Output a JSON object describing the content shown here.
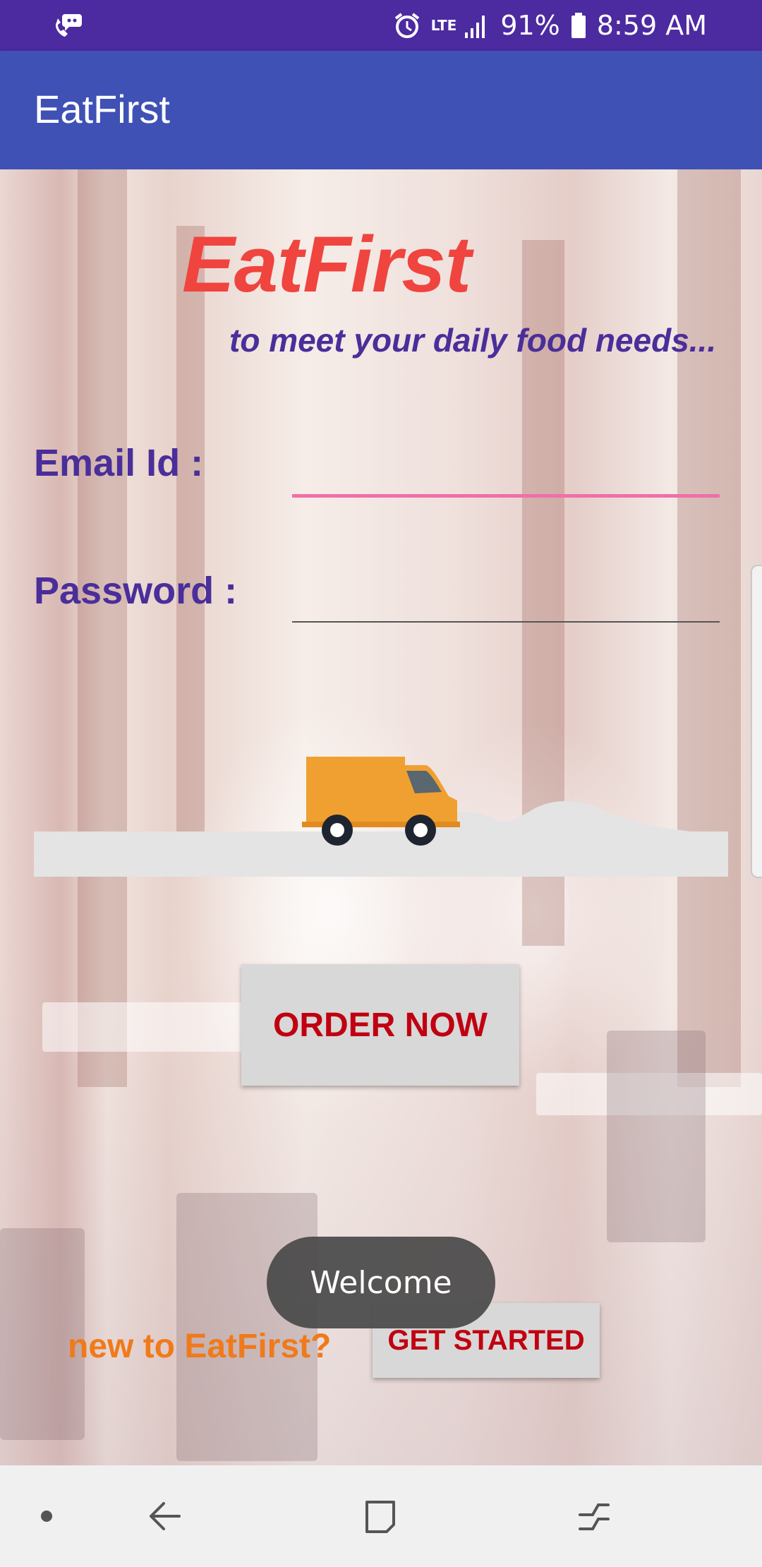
{
  "status_bar": {
    "left_icon": "voicemail-icon",
    "alarm_icon": "alarm-icon",
    "network": "LTE",
    "signal_icon": "signal-icon",
    "battery": "91%",
    "battery_icon": "battery-icon",
    "time": "8:59 AM",
    "color": "#4c2aa0"
  },
  "app_bar": {
    "title": "EatFirst",
    "color": "#3f51b5"
  },
  "login": {
    "brand": "EatFirst",
    "tagline": "to meet your daily food needs...",
    "email_label": "Email Id :",
    "email_value": "",
    "password_label": "Password :",
    "password_value": ""
  },
  "illustration": {
    "icon": "delivery-truck-icon"
  },
  "actions": {
    "order_now": "ORDER NOW",
    "new_prompt": "new to EatFirst?",
    "get_started": "GET STARTED"
  },
  "toast": {
    "message": "Welcome"
  },
  "nav_bar": {
    "items": [
      "dot-icon",
      "back-icon",
      "home-icon",
      "recents-icon"
    ]
  },
  "colors": {
    "brand_red": "#f0443f",
    "label_purple": "#4a2e9a",
    "button_text": "#c00010",
    "prompt_orange": "#f07a1a",
    "email_underline": "#f06fa8"
  }
}
